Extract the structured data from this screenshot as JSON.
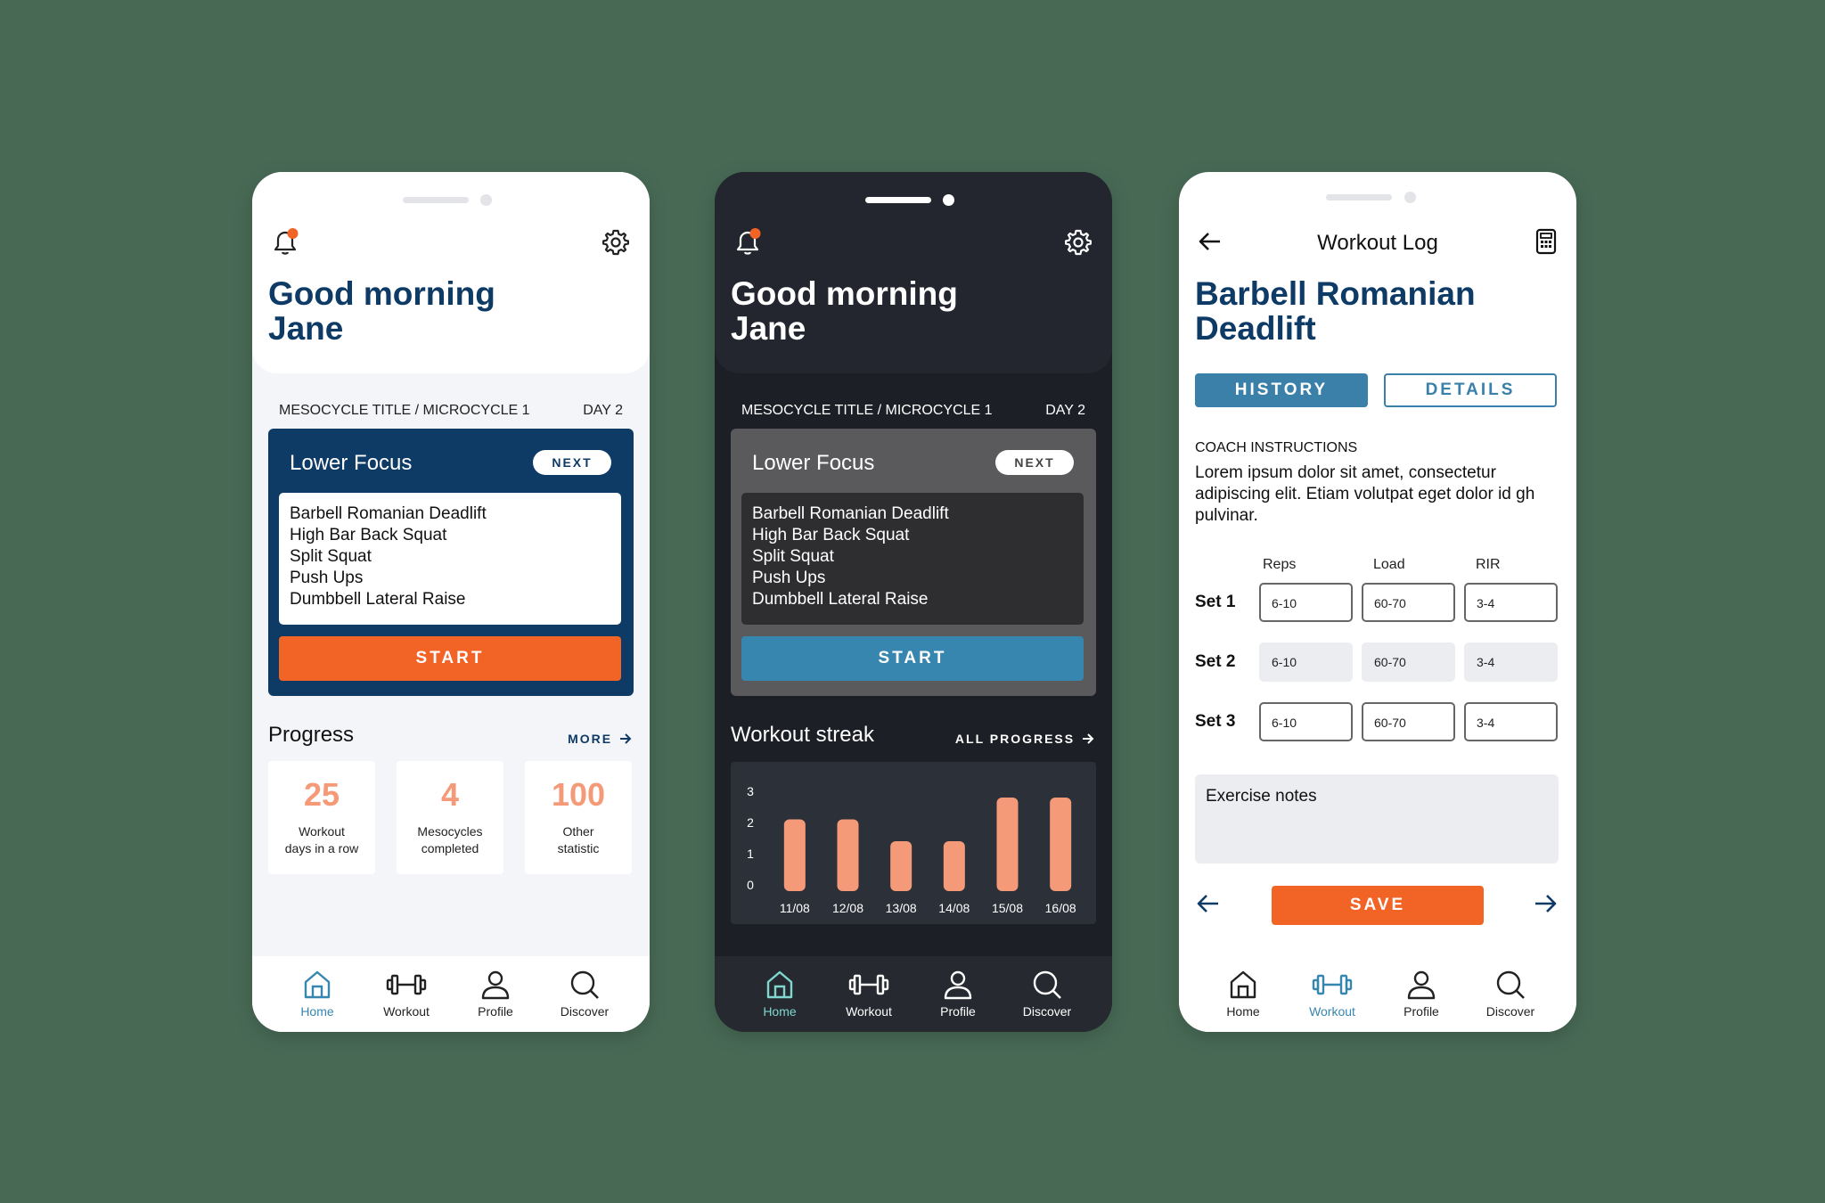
{
  "home": {
    "greeting_line1": "Good morning",
    "greeting_line2": "Jane",
    "mesocycle": "MESOCYCLE TITLE / MICROCYCLE 1",
    "day": "DAY 2",
    "workout_title": "Lower Focus",
    "next_badge": "NEXT",
    "exercises": [
      "Barbell Romanian Deadlift",
      "High Bar Back Squat",
      "Split Squat",
      "Push Ups",
      "Dumbbell Lateral Raise"
    ],
    "start_label": "START"
  },
  "light_screen": {
    "progress_title": "Progress",
    "more_link": "MORE",
    "stats": [
      {
        "value": "25",
        "label_line1": "Workout",
        "label_line2": "days in a row"
      },
      {
        "value": "4",
        "label_line1": "Mesocycles",
        "label_line2": "completed"
      },
      {
        "value": "100",
        "label_line1": "Other",
        "label_line2": "statistic"
      }
    ]
  },
  "dark_screen": {
    "streak_title": "Workout streak",
    "all_progress_link": "ALL PROGRESS"
  },
  "chart_data": {
    "type": "bar",
    "categories": [
      "11/08",
      "12/08",
      "13/08",
      "14/08",
      "15/08",
      "16/08"
    ],
    "values": [
      2.3,
      2.3,
      1.6,
      1.6,
      3,
      3
    ],
    "yticks": [
      "0",
      "1",
      "2",
      "3"
    ],
    "ylim": [
      0,
      3
    ],
    "grid": false,
    "bar_color": "#f49a78"
  },
  "nav": {
    "items": [
      {
        "label": "Home",
        "icon": "home-icon"
      },
      {
        "label": "Workout",
        "icon": "dumbbell-icon"
      },
      {
        "label": "Profile",
        "icon": "person-icon"
      },
      {
        "label": "Discover",
        "icon": "search-icon"
      }
    ]
  },
  "log": {
    "title": "Workout Log",
    "exercise_line1": "Barbell Romanian",
    "exercise_line2": "Deadlift",
    "tab_history": "HISTORY",
    "tab_details": "DETAILS",
    "coach_heading": "COACH INSTRUCTIONS",
    "coach_text": "Lorem ipsum dolor sit amet, consectetur adipiscing elit. Etiam volutpat eget dolor id gh pulvinar.",
    "col_reps": "Reps",
    "col_load": "Load",
    "col_rir": "RIR",
    "sets": [
      {
        "label": "Set 1",
        "reps": "6-10",
        "load": "60-70",
        "rir": "3-4"
      },
      {
        "label": "Set 2",
        "reps": "6-10",
        "load": "60-70",
        "rir": "3-4"
      },
      {
        "label": "Set 3",
        "reps": "6-10",
        "load": "60-70",
        "rir": "3-4"
      }
    ],
    "notes_placeholder": "Exercise notes",
    "save_label": "SAVE"
  },
  "colors": {
    "background": "#486a55",
    "navy": "#0e3a66",
    "orange": "#f26326",
    "blue": "#3686b0",
    "stat_orange": "#f49a78",
    "notification_dot": "#f26326"
  }
}
